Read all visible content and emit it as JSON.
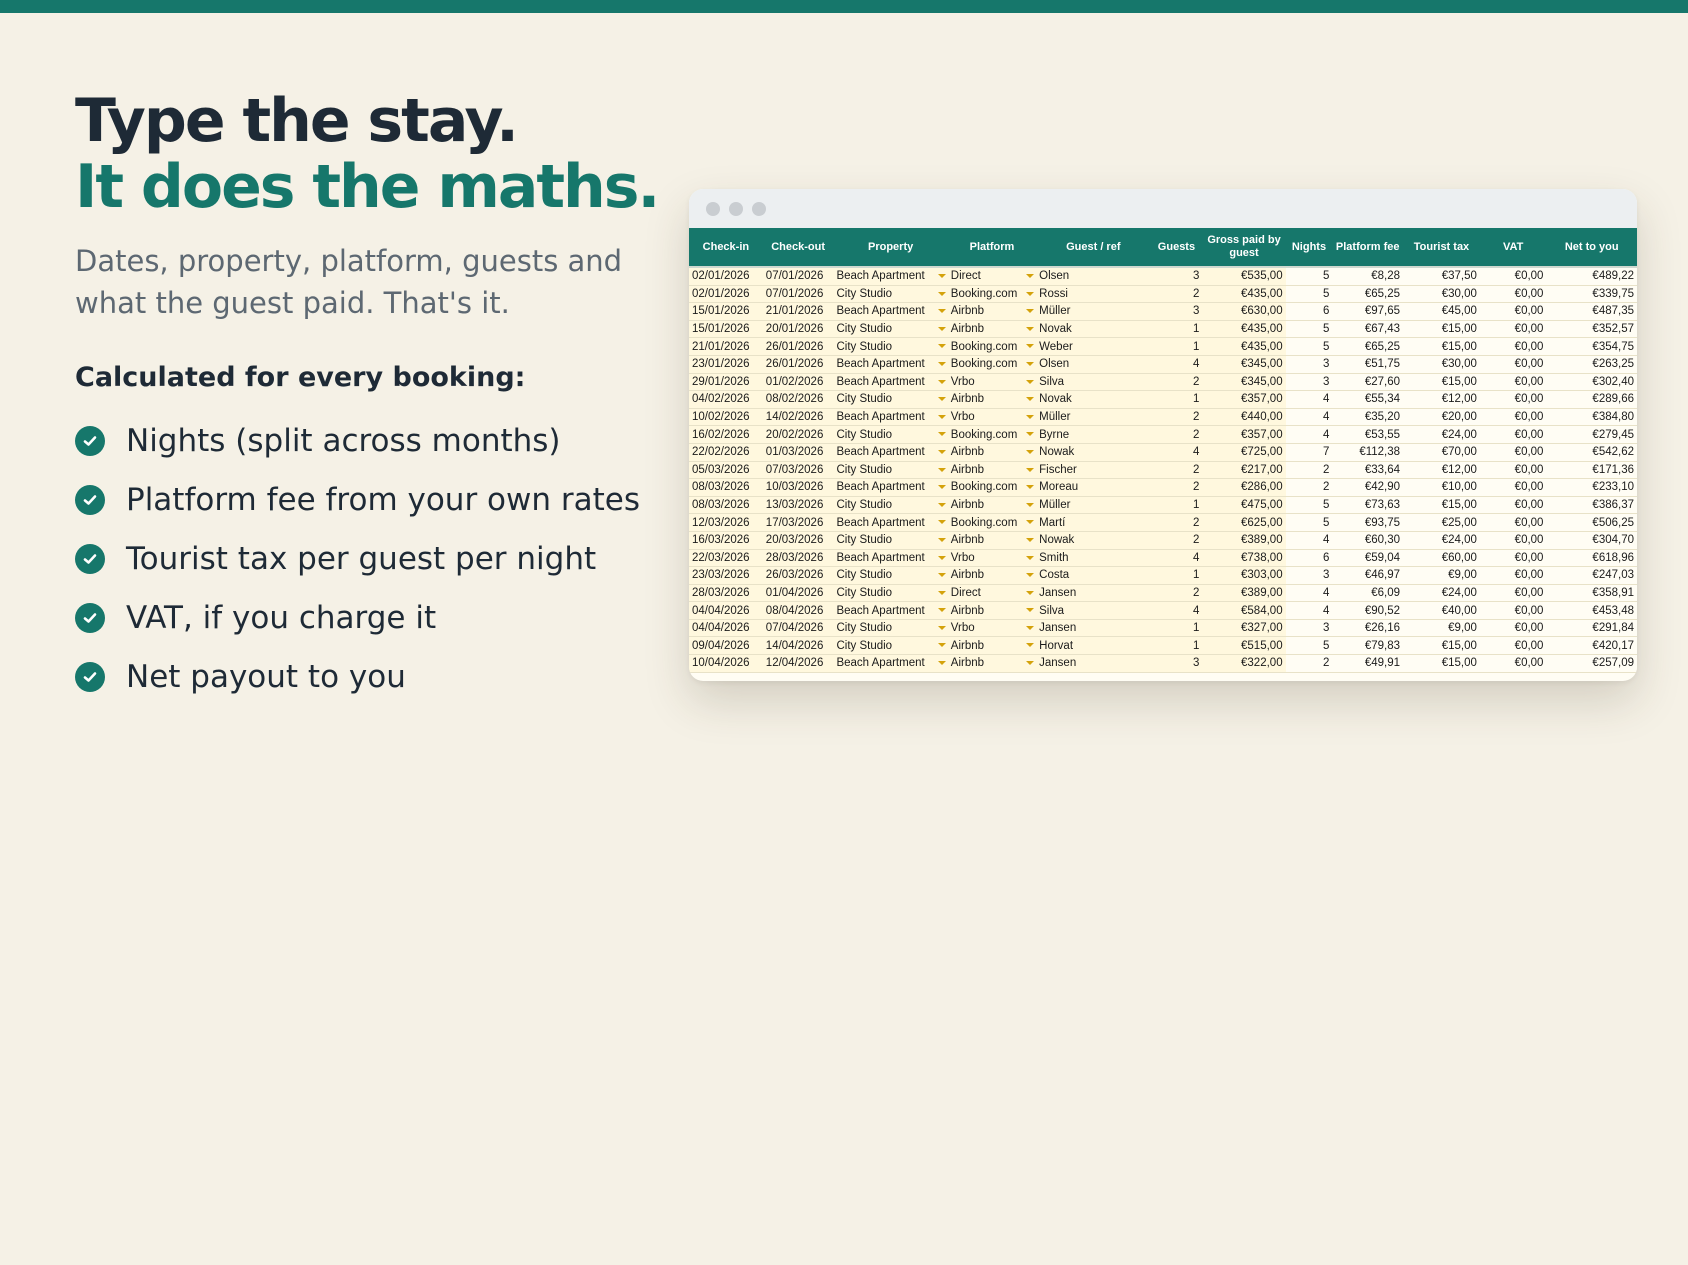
{
  "hero": {
    "line1": "Type the stay.",
    "line2": "It does the maths.",
    "subtitle": "Dates, property, platform, guests and what the guest paid. That's it.",
    "calc_title": "Calculated for every booking:",
    "features": [
      "Nights (split across months)",
      "Platform fee from your own rates",
      "Tourist tax per guest per night",
      "VAT, if you charge it",
      "Net payout to you"
    ]
  },
  "colors": {
    "accent": "#16776b",
    "background": "#f5f1e6",
    "input_cell": "#fff8de",
    "dropdown_arrow": "#d4a20a"
  },
  "icons": {
    "feature": "check-circle-icon",
    "dropdown": "dropdown-arrow-icon"
  },
  "sheet": {
    "columns": [
      "Check-in",
      "Check-out",
      "Property",
      "Platform",
      "Guest / ref",
      "Guests",
      "Gross paid by guest",
      "Nights",
      "Platform fee",
      "Tourist tax",
      "VAT",
      "Net to you"
    ],
    "rows": [
      [
        "02/01/2026",
        "07/01/2026",
        "Beach Apartment",
        "Direct",
        "Olsen",
        "3",
        "€535,00",
        "5",
        "€8,28",
        "€37,50",
        "€0,00",
        "€489,22"
      ],
      [
        "02/01/2026",
        "07/01/2026",
        "City Studio",
        "Booking.com",
        "Rossi",
        "2",
        "€435,00",
        "5",
        "€65,25",
        "€30,00",
        "€0,00",
        "€339,75"
      ],
      [
        "15/01/2026",
        "21/01/2026",
        "Beach Apartment",
        "Airbnb",
        "Müller",
        "3",
        "€630,00",
        "6",
        "€97,65",
        "€45,00",
        "€0,00",
        "€487,35"
      ],
      [
        "15/01/2026",
        "20/01/2026",
        "City Studio",
        "Airbnb",
        "Novak",
        "1",
        "€435,00",
        "5",
        "€67,43",
        "€15,00",
        "€0,00",
        "€352,57"
      ],
      [
        "21/01/2026",
        "26/01/2026",
        "City Studio",
        "Booking.com",
        "Weber",
        "1",
        "€435,00",
        "5",
        "€65,25",
        "€15,00",
        "€0,00",
        "€354,75"
      ],
      [
        "23/01/2026",
        "26/01/2026",
        "Beach Apartment",
        "Booking.com",
        "Olsen",
        "4",
        "€345,00",
        "3",
        "€51,75",
        "€30,00",
        "€0,00",
        "€263,25"
      ],
      [
        "29/01/2026",
        "01/02/2026",
        "Beach Apartment",
        "Vrbo",
        "Silva",
        "2",
        "€345,00",
        "3",
        "€27,60",
        "€15,00",
        "€0,00",
        "€302,40"
      ],
      [
        "04/02/2026",
        "08/02/2026",
        "City Studio",
        "Airbnb",
        "Novak",
        "1",
        "€357,00",
        "4",
        "€55,34",
        "€12,00",
        "€0,00",
        "€289,66"
      ],
      [
        "10/02/2026",
        "14/02/2026",
        "Beach Apartment",
        "Vrbo",
        "Müller",
        "2",
        "€440,00",
        "4",
        "€35,20",
        "€20,00",
        "€0,00",
        "€384,80"
      ],
      [
        "16/02/2026",
        "20/02/2026",
        "City Studio",
        "Booking.com",
        "Byrne",
        "2",
        "€357,00",
        "4",
        "€53,55",
        "€24,00",
        "€0,00",
        "€279,45"
      ],
      [
        "22/02/2026",
        "01/03/2026",
        "Beach Apartment",
        "Airbnb",
        "Nowak",
        "4",
        "€725,00",
        "7",
        "€112,38",
        "€70,00",
        "€0,00",
        "€542,62"
      ],
      [
        "05/03/2026",
        "07/03/2026",
        "City Studio",
        "Airbnb",
        "Fischer",
        "2",
        "€217,00",
        "2",
        "€33,64",
        "€12,00",
        "€0,00",
        "€171,36"
      ],
      [
        "08/03/2026",
        "10/03/2026",
        "Beach Apartment",
        "Booking.com",
        "Moreau",
        "2",
        "€286,00",
        "2",
        "€42,90",
        "€10,00",
        "€0,00",
        "€233,10"
      ],
      [
        "08/03/2026",
        "13/03/2026",
        "City Studio",
        "Airbnb",
        "Müller",
        "1",
        "€475,00",
        "5",
        "€73,63",
        "€15,00",
        "€0,00",
        "€386,37"
      ],
      [
        "12/03/2026",
        "17/03/2026",
        "Beach Apartment",
        "Booking.com",
        "Martí",
        "2",
        "€625,00",
        "5",
        "€93,75",
        "€25,00",
        "€0,00",
        "€506,25"
      ],
      [
        "16/03/2026",
        "20/03/2026",
        "City Studio",
        "Airbnb",
        "Nowak",
        "2",
        "€389,00",
        "4",
        "€60,30",
        "€24,00",
        "€0,00",
        "€304,70"
      ],
      [
        "22/03/2026",
        "28/03/2026",
        "Beach Apartment",
        "Vrbo",
        "Smith",
        "4",
        "€738,00",
        "6",
        "€59,04",
        "€60,00",
        "€0,00",
        "€618,96"
      ],
      [
        "23/03/2026",
        "26/03/2026",
        "City Studio",
        "Airbnb",
        "Costa",
        "1",
        "€303,00",
        "3",
        "€46,97",
        "€9,00",
        "€0,00",
        "€247,03"
      ],
      [
        "28/03/2026",
        "01/04/2026",
        "City Studio",
        "Direct",
        "Jansen",
        "2",
        "€389,00",
        "4",
        "€6,09",
        "€24,00",
        "€0,00",
        "€358,91"
      ],
      [
        "04/04/2026",
        "08/04/2026",
        "Beach Apartment",
        "Airbnb",
        "Silva",
        "4",
        "€584,00",
        "4",
        "€90,52",
        "€40,00",
        "€0,00",
        "€453,48"
      ],
      [
        "04/04/2026",
        "07/04/2026",
        "City Studio",
        "Vrbo",
        "Jansen",
        "1",
        "€327,00",
        "3",
        "€26,16",
        "€9,00",
        "€0,00",
        "€291,84"
      ],
      [
        "09/04/2026",
        "14/04/2026",
        "City Studio",
        "Airbnb",
        "Horvat",
        "1",
        "€515,00",
        "5",
        "€79,83",
        "€15,00",
        "€0,00",
        "€420,17"
      ],
      [
        "10/04/2026",
        "12/04/2026",
        "Beach Apartment",
        "Airbnb",
        "Jansen",
        "3",
        "€322,00",
        "2",
        "€49,91",
        "€15,00",
        "€0,00",
        "€257,09"
      ]
    ]
  }
}
